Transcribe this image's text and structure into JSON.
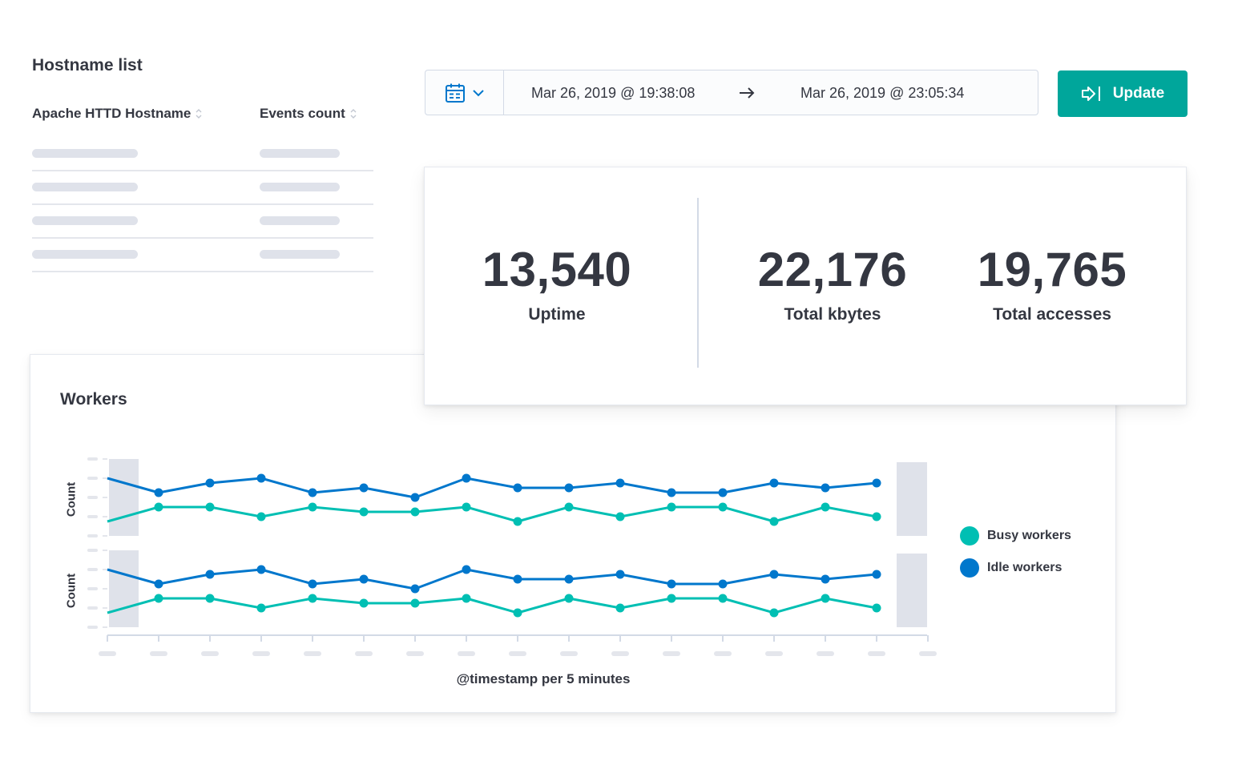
{
  "hostname_list": {
    "title": "Hostname list",
    "columns": [
      "Apache HTTD Hostname",
      "Events count"
    ],
    "row_count": 4
  },
  "date_picker": {
    "icon": "calendar-icon",
    "start": "Mar 26, 2019 @ 19:38:08",
    "end": "Mar 26, 2019 @ 23:05:34"
  },
  "update_button": {
    "label": "Update",
    "icon": "refresh-arrow-icon"
  },
  "metrics": [
    {
      "value": "13,540",
      "label": "Uptime"
    },
    {
      "value": "22,176",
      "label": "Total kbytes"
    },
    {
      "value": "19,765",
      "label": "Total accesses"
    }
  ],
  "workers": {
    "title": "Workers",
    "ylabel": "Count",
    "xlabel": "@timestamp per 5 minutes",
    "legend": [
      {
        "name": "Busy workers",
        "color": "#00bfb3"
      },
      {
        "name": "Idle workers",
        "color": "#0077cc"
      }
    ]
  },
  "chart_data": {
    "type": "line",
    "title": "Workers",
    "xlabel": "@timestamp per 5 minutes",
    "ylabel": "Count",
    "series": [
      {
        "name": "Idle workers",
        "color": "#0077cc",
        "values": [
          3.0,
          2.25,
          2.75,
          3.0,
          2.25,
          2.5,
          2.0,
          3.0,
          2.5,
          2.5,
          2.75,
          2.25,
          2.25,
          2.75,
          2.5,
          2.75
        ]
      },
      {
        "name": "Busy workers",
        "color": "#00bfb3",
        "values": [
          0.75,
          1.5,
          1.5,
          1.0,
          1.5,
          1.25,
          1.25,
          1.5,
          0.75,
          1.5,
          1.0,
          1.5,
          1.5,
          0.75,
          1.5,
          1.0
        ]
      }
    ]
  }
}
